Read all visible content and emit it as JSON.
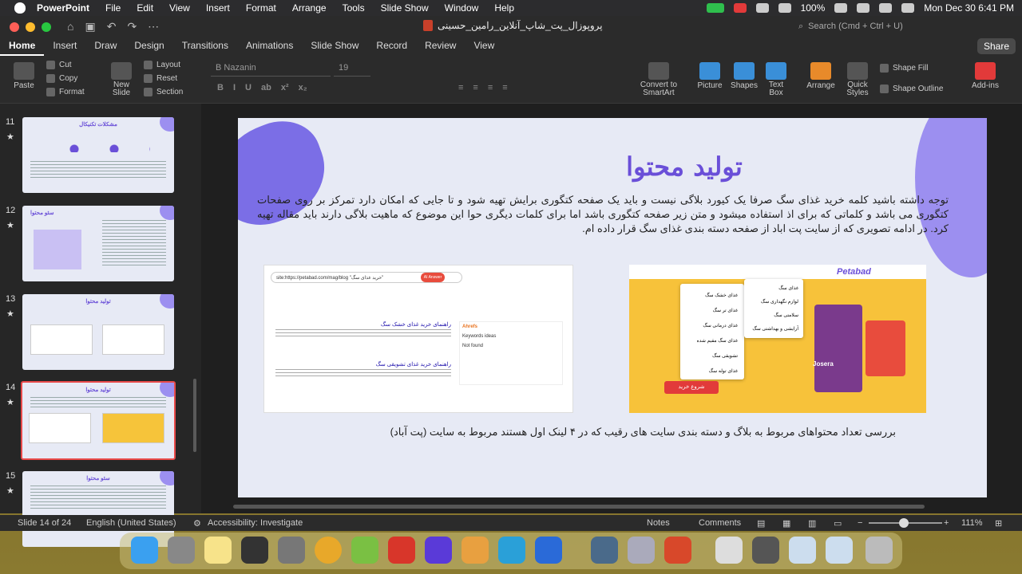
{
  "menubar": {
    "app": "PowerPoint",
    "items": [
      "File",
      "Edit",
      "View",
      "Insert",
      "Format",
      "Arrange",
      "Tools",
      "Slide Show",
      "Window",
      "Help"
    ],
    "battery": "100%",
    "datetime": "Mon Dec 30  6:41 PM"
  },
  "window": {
    "title": "پروپوزال_پت_شاپ_آنلاین_رامین_حسینی",
    "search_placeholder": "Search (Cmd + Ctrl + U)"
  },
  "tabs": [
    "Home",
    "Insert",
    "Draw",
    "Design",
    "Transitions",
    "Animations",
    "Slide Show",
    "Record",
    "Review",
    "View"
  ],
  "share_label": "Share",
  "ribbon": {
    "paste": "Paste",
    "cut": "Cut",
    "copy": "Copy",
    "format": "Format",
    "new_slide": "New Slide",
    "layout": "Layout",
    "reset": "Reset",
    "section": "Section",
    "font_name": "B Nazanin",
    "font_size": "19",
    "convert": "Convert to SmartArt",
    "picture": "Picture",
    "shapes": "Shapes",
    "textbox": "Text Box",
    "arrange": "Arrange",
    "quick_styles": "Quick Styles",
    "shape_fill": "Shape Fill",
    "shape_outline": "Shape Outline",
    "addins": "Add-ins"
  },
  "thumbnails": [
    {
      "num": "11",
      "title": "مشکلات تکنیکال"
    },
    {
      "num": "12",
      "title": "سئو محتوا"
    },
    {
      "num": "13",
      "title": "تولید محتوا"
    },
    {
      "num": "14",
      "title": "تولید محتوا"
    },
    {
      "num": "15",
      "title": "سئو محتوا"
    }
  ],
  "slide": {
    "title": "تولید محتوا",
    "body": "توجه داشته باشید کلمه خرید غذای سگ صرفا یک کیورد بلاگی نیست و باید یک صفحه کتگوری برایش تهیه شود و تا جایی که امکان دارد تمرکز بر روی صفحات کتگوری می باشد و کلماتی که برای اذ استفاده میشود و متن زیر صفحه کتگوری باشد اما برای کلمات دیگری حوا این موضوع که ماهیت بلاگی دارند باید مقاله تهیه کرد. در ادامه تصویری که از سایت پت اباد از صفحه دسته بندی غذای سگ قرار داده ام.",
    "search_query": "site:https://petabad.com/mag/blog \"خرید غذای سگ\"",
    "ai_label": "AI Answer",
    "result1_title": "راهنمای خرید غذای خشک سگ",
    "result2_title": "راهنمای خرید غذای تشویقی سگ",
    "ahrefs_label": "Ahrefs",
    "keywords_label": "Keywords ideas",
    "not_found": "Not found",
    "petabad_logo": "Petabad",
    "menu_items": [
      "غذای خشک سگ",
      "غذای تر سگ",
      "غذای درمانی سگ",
      "غذای سگ مقیم شده",
      "تشویقی سگ",
      "غذای توله سگ"
    ],
    "submenu_items": [
      "غذای سگ",
      "لوازم نگهداری سگ",
      "سلامتی سگ",
      "آرایشی و بهداشتی سگ"
    ],
    "buy_button": "شروع خرید",
    "brand": "Josera",
    "caption": "بررسی تعداد محتواهای مربوط به بلاگ و دسته بندی سایت های رقیب که در ۴ لینک اول هستند مربوط به سایت (پت آباد)"
  },
  "status": {
    "slide_of": "Slide 14 of 24",
    "language": "English (United States)",
    "accessibility": "Accessibility: Investigate",
    "notes": "Notes",
    "comments": "Comments",
    "zoom": "111%"
  }
}
